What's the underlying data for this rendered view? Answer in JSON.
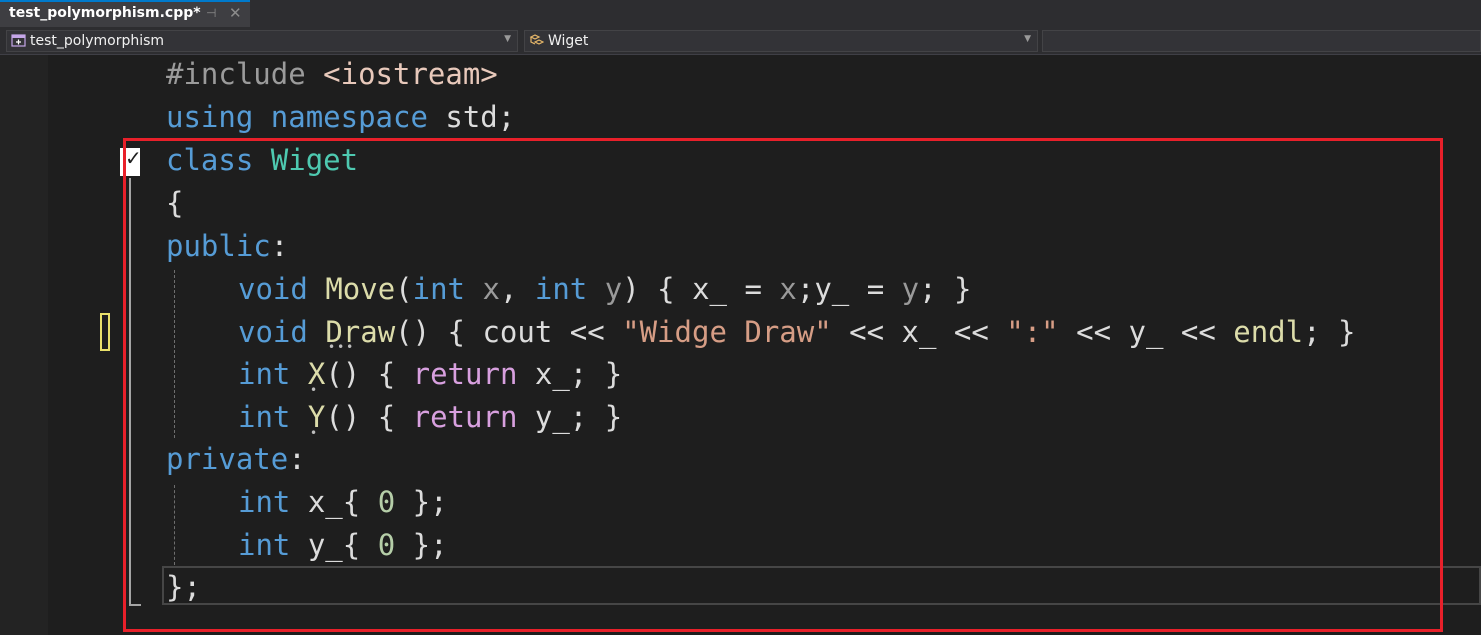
{
  "tab": {
    "title": "test_polymorphism.cpp*",
    "pin_glyph": "⊣",
    "close_glyph": "✕"
  },
  "navbar": {
    "project_scope": "test_polymorphism",
    "type_scope": "Wiget",
    "member_scope": ""
  },
  "icons": {
    "project_icon": "project-icon",
    "class_icon": "class-icon",
    "dropdown_icon": "chevron-down-icon",
    "fold_icon": "collapse-check-icon"
  },
  "code": {
    "line1": {
      "pre": "#include",
      "inc": "<iostream>"
    },
    "line2": {
      "kw1": "using",
      "kw2": "namespace",
      "rest": "std;"
    },
    "line3": {
      "kw": "class",
      "name": "Wiget"
    },
    "line4": "{",
    "line5": {
      "kw": "public",
      "colon": ":"
    },
    "line6": {
      "t1": "void",
      "fn": "Move",
      "open": "(",
      "t2": "int",
      "p1": "x",
      "comma": ",",
      "t3": "int",
      "p2": "y",
      "close": ")",
      "body1": " { x_ = ",
      "x": "x",
      "semi1": ";",
      "body2": "y_ = ",
      "y": "y",
      "tail": "; }"
    },
    "line7": {
      "t1": "void",
      "fn": "Draw",
      "parens": "()",
      "body1": " { cout << ",
      "s1": "\"Widge Draw\"",
      "body2": " << x_ << ",
      "s2": "\":\"",
      "body3": " << y_ << ",
      "endl": "endl",
      "tail": "; }"
    },
    "line8": {
      "t": "int",
      "fn": "X",
      "parens": "()",
      "b1": " { ",
      "ret": "return",
      "b2": " x_; }"
    },
    "line9": {
      "t": "int",
      "fn": "Y",
      "parens": "()",
      "b1": " { ",
      "ret": "return",
      "b2": " y_; }"
    },
    "line10": {
      "kw": "private",
      "colon": ":"
    },
    "line11": {
      "t": "int",
      "body1": " x_{ ",
      "num": "0",
      "body2": " };"
    },
    "line12": {
      "t": "int",
      "body1": " y_{ ",
      "num": "0",
      "body2": " };"
    },
    "line13": "};"
  },
  "colors": {
    "keyword": "#569cd6",
    "control_keyword": "#d8a0df",
    "class_name": "#4ec9b0",
    "string": "#d69d85",
    "function": "#dcdcaa",
    "highlight_box": "#e8202a"
  }
}
